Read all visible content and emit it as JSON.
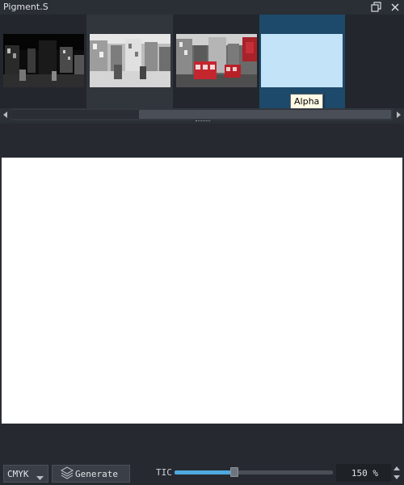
{
  "window": {
    "title": "Pigment.S"
  },
  "thumbnails": [
    {
      "name": "original"
    },
    {
      "name": "desaturated"
    },
    {
      "name": "red-highlight"
    },
    {
      "name": "alpha",
      "color": "#c3e3f8"
    }
  ],
  "tooltip": {
    "text": "Alpha"
  },
  "colors": {
    "background": "#2a2e35",
    "selected": "#1d4a6a",
    "accent": "#4fa8df",
    "canvas": "#ffffff"
  },
  "bottom": {
    "color_mode": "CMYK",
    "generate_label": "Generate",
    "tic_label": "TIC",
    "tic_fraction": 0.38,
    "zoom_value": "150 %"
  }
}
